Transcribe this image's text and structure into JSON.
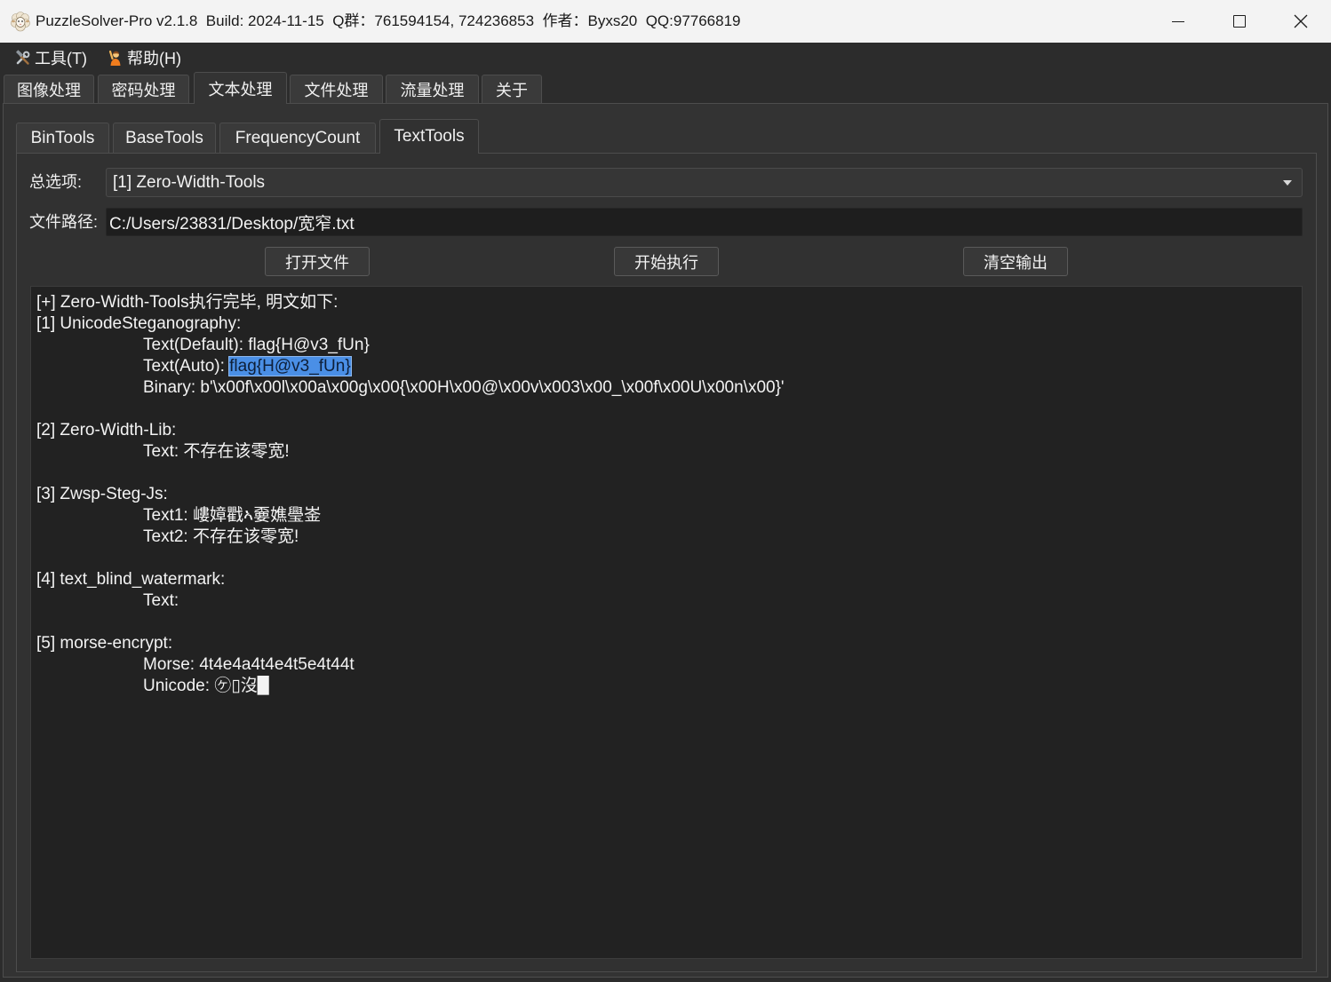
{
  "window": {
    "title": "PuzzleSolver-Pro v2.1.8  Build: 2024-11-15  Q群：761594154, 724236853  作者：Byxs20  QQ:97766819",
    "app_icon": "sheep-icon",
    "controls": [
      "minimize-icon",
      "maximize-icon",
      "close-icon"
    ]
  },
  "menu": {
    "tools": {
      "label": "工具(T)",
      "icon": "tools-icon"
    },
    "help": {
      "label": "帮助(H)",
      "icon": "help-person-icon"
    }
  },
  "main_tabs": [
    {
      "label": "图像处理",
      "selected": false
    },
    {
      "label": "密码处理",
      "selected": false
    },
    {
      "label": "文本处理",
      "selected": true
    },
    {
      "label": "文件处理",
      "selected": false
    },
    {
      "label": "流量处理",
      "selected": false
    },
    {
      "label": "关于",
      "selected": false
    }
  ],
  "sub_tabs": [
    {
      "label": "BinTools",
      "selected": false
    },
    {
      "label": "BaseTools",
      "selected": false
    },
    {
      "label": "FrequencyCount",
      "selected": false
    },
    {
      "label": "TextTools",
      "selected": true
    }
  ],
  "form": {
    "option_label": "总选项:",
    "option_value": "[1] Zero-Width-Tools",
    "option_icon": "chevron-down-icon",
    "path_label": "文件路径:",
    "path_value": "C:/Users/23831/Desktop/宽窄.txt"
  },
  "buttons": {
    "open_file": "打开文件",
    "run": "开始执行",
    "clear_output": "清空输出"
  },
  "output": {
    "lines": [
      {
        "text": "[+] Zero-Width-Tools执行完毕, 明文如下:"
      },
      {
        "text": "[1] UnicodeSteganography:"
      },
      {
        "text": "\t\tText(Default): flag{H@v3_fUn}"
      },
      {
        "text": "\t\tText(Auto): ",
        "selected": "flag{H@v3_fUn}"
      },
      {
        "text": "\t\tBinary: b'\\x00f\\x00l\\x00a\\x00g\\x00{\\x00H\\x00@\\x00v\\x003\\x00_\\x00f\\x00U\\x00n\\x00}'"
      },
      {
        "text": "[2] Zero-Width-Lib:"
      },
      {
        "text": "\t\tText: 不存在该零宽!"
      },
      {
        "text": "[3] Zwsp-Steg-Js:"
      },
      {
        "text": "\t\tText1: 嶁嫜戵ኣ嫑嫶璺崟"
      },
      {
        "text": "\t\tText2: 不存在该零宽!"
      },
      {
        "text": "[4] text_blind_watermark:"
      },
      {
        "text": "\t\tText:"
      },
      {
        "text": "[5] morse-encrypt:"
      },
      {
        "text": "\t\tMorse: 4t4e4a4t4e4t5e4t44t"
      },
      {
        "text": "\t\tUnicode: ㋘▯沒▉"
      }
    ]
  },
  "theme": {
    "title_bar": "#f3f3f3",
    "window_background": "#2c2c2c",
    "output_background": "#222222",
    "selection_highlight": "#4a8fe6"
  }
}
